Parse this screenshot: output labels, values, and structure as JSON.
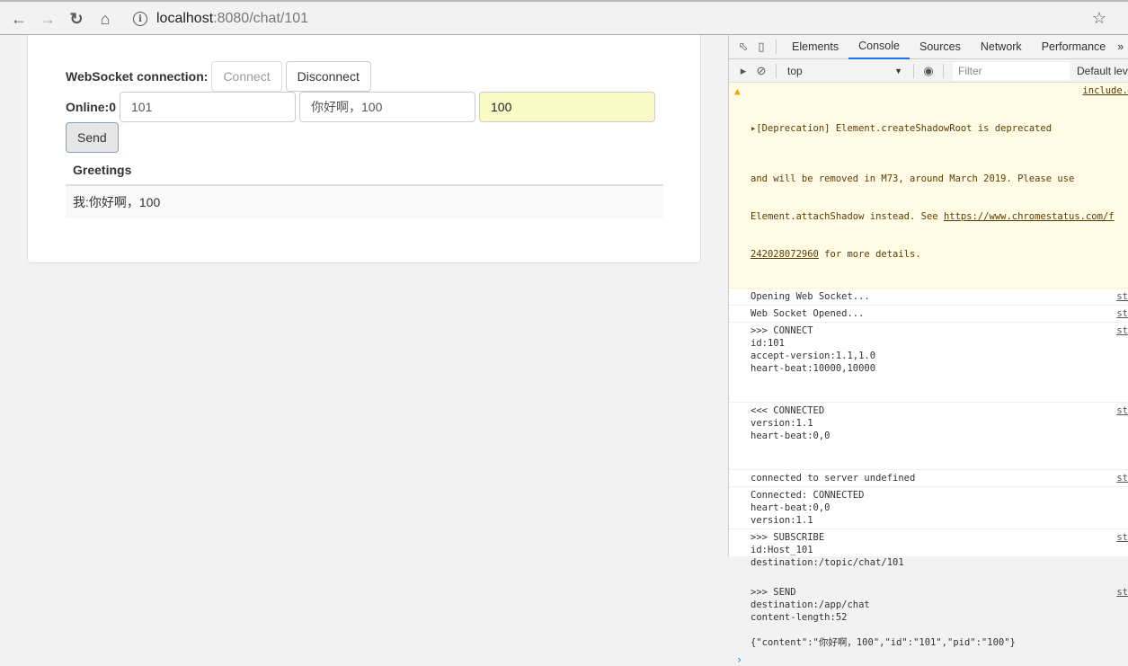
{
  "browser": {
    "url_host": "localhost",
    "url_rest": ":8080/chat/101",
    "icons": [
      "back-arrow-icon",
      "forward-arrow-icon",
      "reload-icon",
      "home-icon",
      "info-icon",
      "star-icon"
    ]
  },
  "page": {
    "connection_label": "WebSocket connection:",
    "connect_label": "Connect",
    "disconnect_label": "Disconnect",
    "online_label": "Online:0",
    "id_value": "101",
    "message_value": "你好啊，100",
    "pid_value": "100",
    "send_label": "Send",
    "greetings_header": "Greetings",
    "greetings": [
      "我:你好啊，100"
    ]
  },
  "devtools": {
    "tabs": [
      "Elements",
      "Console",
      "Sources",
      "Network",
      "Performance"
    ],
    "active_tab": "Console",
    "more_label": "»",
    "context": "top",
    "filter_placeholder": "Filter",
    "levels_label": "Default lev",
    "warning": {
      "line1": "▸[Deprecation] Element.createShadowRoot is deprecated",
      "src": "include.",
      "line2": "and will be removed in M73, around March 2019. Please use",
      "line3_pre": "Element.attachShadow instead. See ",
      "line3_link": "https://www.chromestatus.com/f",
      "line4_link": "242028072960",
      "line4_post": " for more details."
    },
    "messages": [
      {
        "text": "Opening Web Socket...",
        "src": "st"
      },
      {
        "text": "Web Socket Opened...",
        "src": "st"
      },
      {
        "text": ">>> CONNECT\nid:101\naccept-version:1.1,1.0\nheart-beat:10000,10000\n\n\n",
        "src": "st"
      },
      {
        "text": "<<< CONNECTED\nversion:1.1\nheart-beat:0,0\n\n\n",
        "src": "st"
      },
      {
        "text": "connected to server undefined",
        "src": "st"
      },
      {
        "text": "Connected: CONNECTED\nheart-beat:0,0\nversion:1.1\n",
        "src": ""
      },
      {
        "text": ">>> SUBSCRIBE\nid:Host_101\ndestination:/topic/chat/101\n\n",
        "src": "st"
      },
      {
        "text": ">>> SEND\ndestination:/app/chat\ncontent-length:52\n\n{\"content\":\"你好啊，100\",\"id\":\"101\",\"pid\":\"100\"}",
        "src": "st"
      }
    ],
    "prompt": "›"
  }
}
